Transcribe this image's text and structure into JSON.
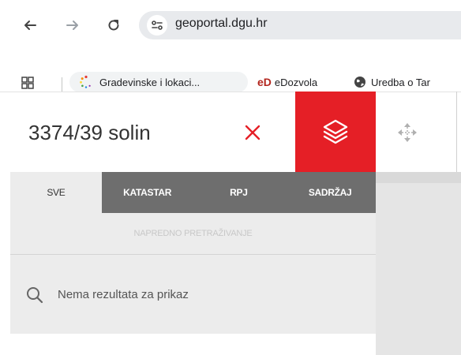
{
  "browser": {
    "url": "geoportal.dgu.hr",
    "bookmarks": [
      {
        "label": "Gradevinske i lokaci..."
      },
      {
        "label": "eDozvola",
        "logo": "eD"
      },
      {
        "label": "Uredba o Tar"
      }
    ]
  },
  "header": {
    "search_value": "3374/39 solin"
  },
  "tabs": [
    {
      "label": "SVE",
      "active": true
    },
    {
      "label": "KATASTAR"
    },
    {
      "label": "RPJ"
    },
    {
      "label": "SADRŽAJ"
    }
  ],
  "advanced_search_label": "NAPREDNO PRETRAŽIVANJE",
  "results": {
    "message": "Nema rezultata za prikaz"
  },
  "colors": {
    "accent": "#e51f26",
    "tab_bar": "#6e6e6e",
    "panel": "#ececec"
  },
  "icons": [
    "back-arrow-icon",
    "forward-arrow-icon",
    "reload-icon",
    "site-info-icon",
    "apps-grid-icon",
    "loading-spinner-icon",
    "globe-icon",
    "close-icon",
    "layers-icon",
    "move-icon",
    "search-icon"
  ]
}
